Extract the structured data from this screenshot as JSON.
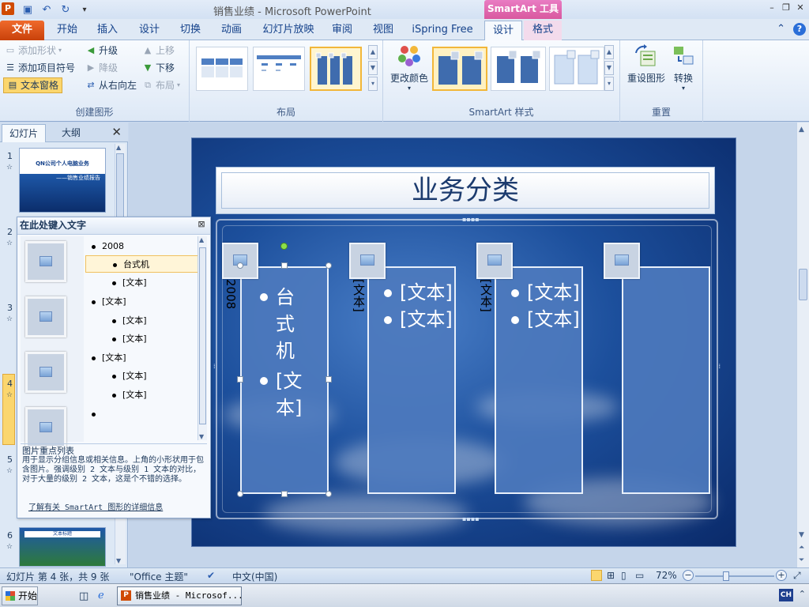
{
  "app": {
    "title": "销售业绩 - Microsoft PowerPoint",
    "app_icon": "P",
    "contextual_header": "SmartArt 工具"
  },
  "tabs": [
    "文件",
    "开始",
    "插入",
    "设计",
    "切换",
    "动画",
    "幻灯片放映",
    "审阅",
    "视图",
    "iSpring Free",
    "设计",
    "格式"
  ],
  "ribbon": {
    "create_graphic": {
      "label": "创建图形",
      "add_shape": "添加形状",
      "add_bullet": "添加项目符号",
      "text_pane": "文本窗格",
      "promote": "升级",
      "demote": "降级",
      "right_to_left": "从右向左",
      "move_up": "上移",
      "move_down": "下移",
      "layout": "布局"
    },
    "layouts_label": "布局",
    "styles": {
      "label": "SmartArt 样式",
      "change_colors": "更改颜色"
    },
    "reset": {
      "label": "重置",
      "reset_graphic": "重设图形",
      "convert": "转换"
    }
  },
  "left_pane": {
    "tab_slides": "幻灯片",
    "tab_outline": "大纲",
    "slide_numbers": [
      "1",
      "2",
      "3",
      "4",
      "5",
      "6"
    ],
    "thumb1_title": "QN公司个人电脑业务",
    "thumb1_sub": "——销售业绩报告",
    "thumb6_title": "文本标题"
  },
  "slide": {
    "title": "业务分类",
    "col1_label": "2008",
    "col1_items": [
      "台式机",
      "[文本]"
    ],
    "col2_label": "[文本]",
    "col2_items": [
      "[文本]",
      "[文本]"
    ],
    "col3_label": "[文本]",
    "col3_items": [
      "[文本]",
      "[文本]"
    ]
  },
  "text_pane": {
    "header": "在此处键入文字",
    "items": [
      {
        "level": 1,
        "text": "2008"
      },
      {
        "level": 2,
        "text": "台式机"
      },
      {
        "level": 2,
        "text": "[文本]"
      },
      {
        "level": 1,
        "text": "[文本]"
      },
      {
        "level": 2,
        "text": "[文本]"
      },
      {
        "level": 2,
        "text": "[文本]"
      },
      {
        "level": 1,
        "text": "[文本]"
      },
      {
        "level": 2,
        "text": "[文本]"
      },
      {
        "level": 2,
        "text": "[文本]"
      },
      {
        "level": 1,
        "text": ""
      }
    ],
    "desc_title": "图片重点列表",
    "desc_body": "用于显示分组信息或相关信息。上角的小形状用于包含图片。强调级别 2 文本与级别 1 文本的对比，对于大量的级别 2 文本，这是个不错的选择。",
    "desc_link": "了解有关 SmartArt 图形的详细信息"
  },
  "status": {
    "slide_info": "幻灯片 第 4 张，共 9 张",
    "theme": "\"Office 主题\"",
    "language": "中文(中国)",
    "zoom": "72%",
    "zoom_fraction": 0.38
  },
  "taskbar": {
    "start": "开始",
    "app_item": "销售业绩 - Microsof...",
    "tray": "CH"
  }
}
